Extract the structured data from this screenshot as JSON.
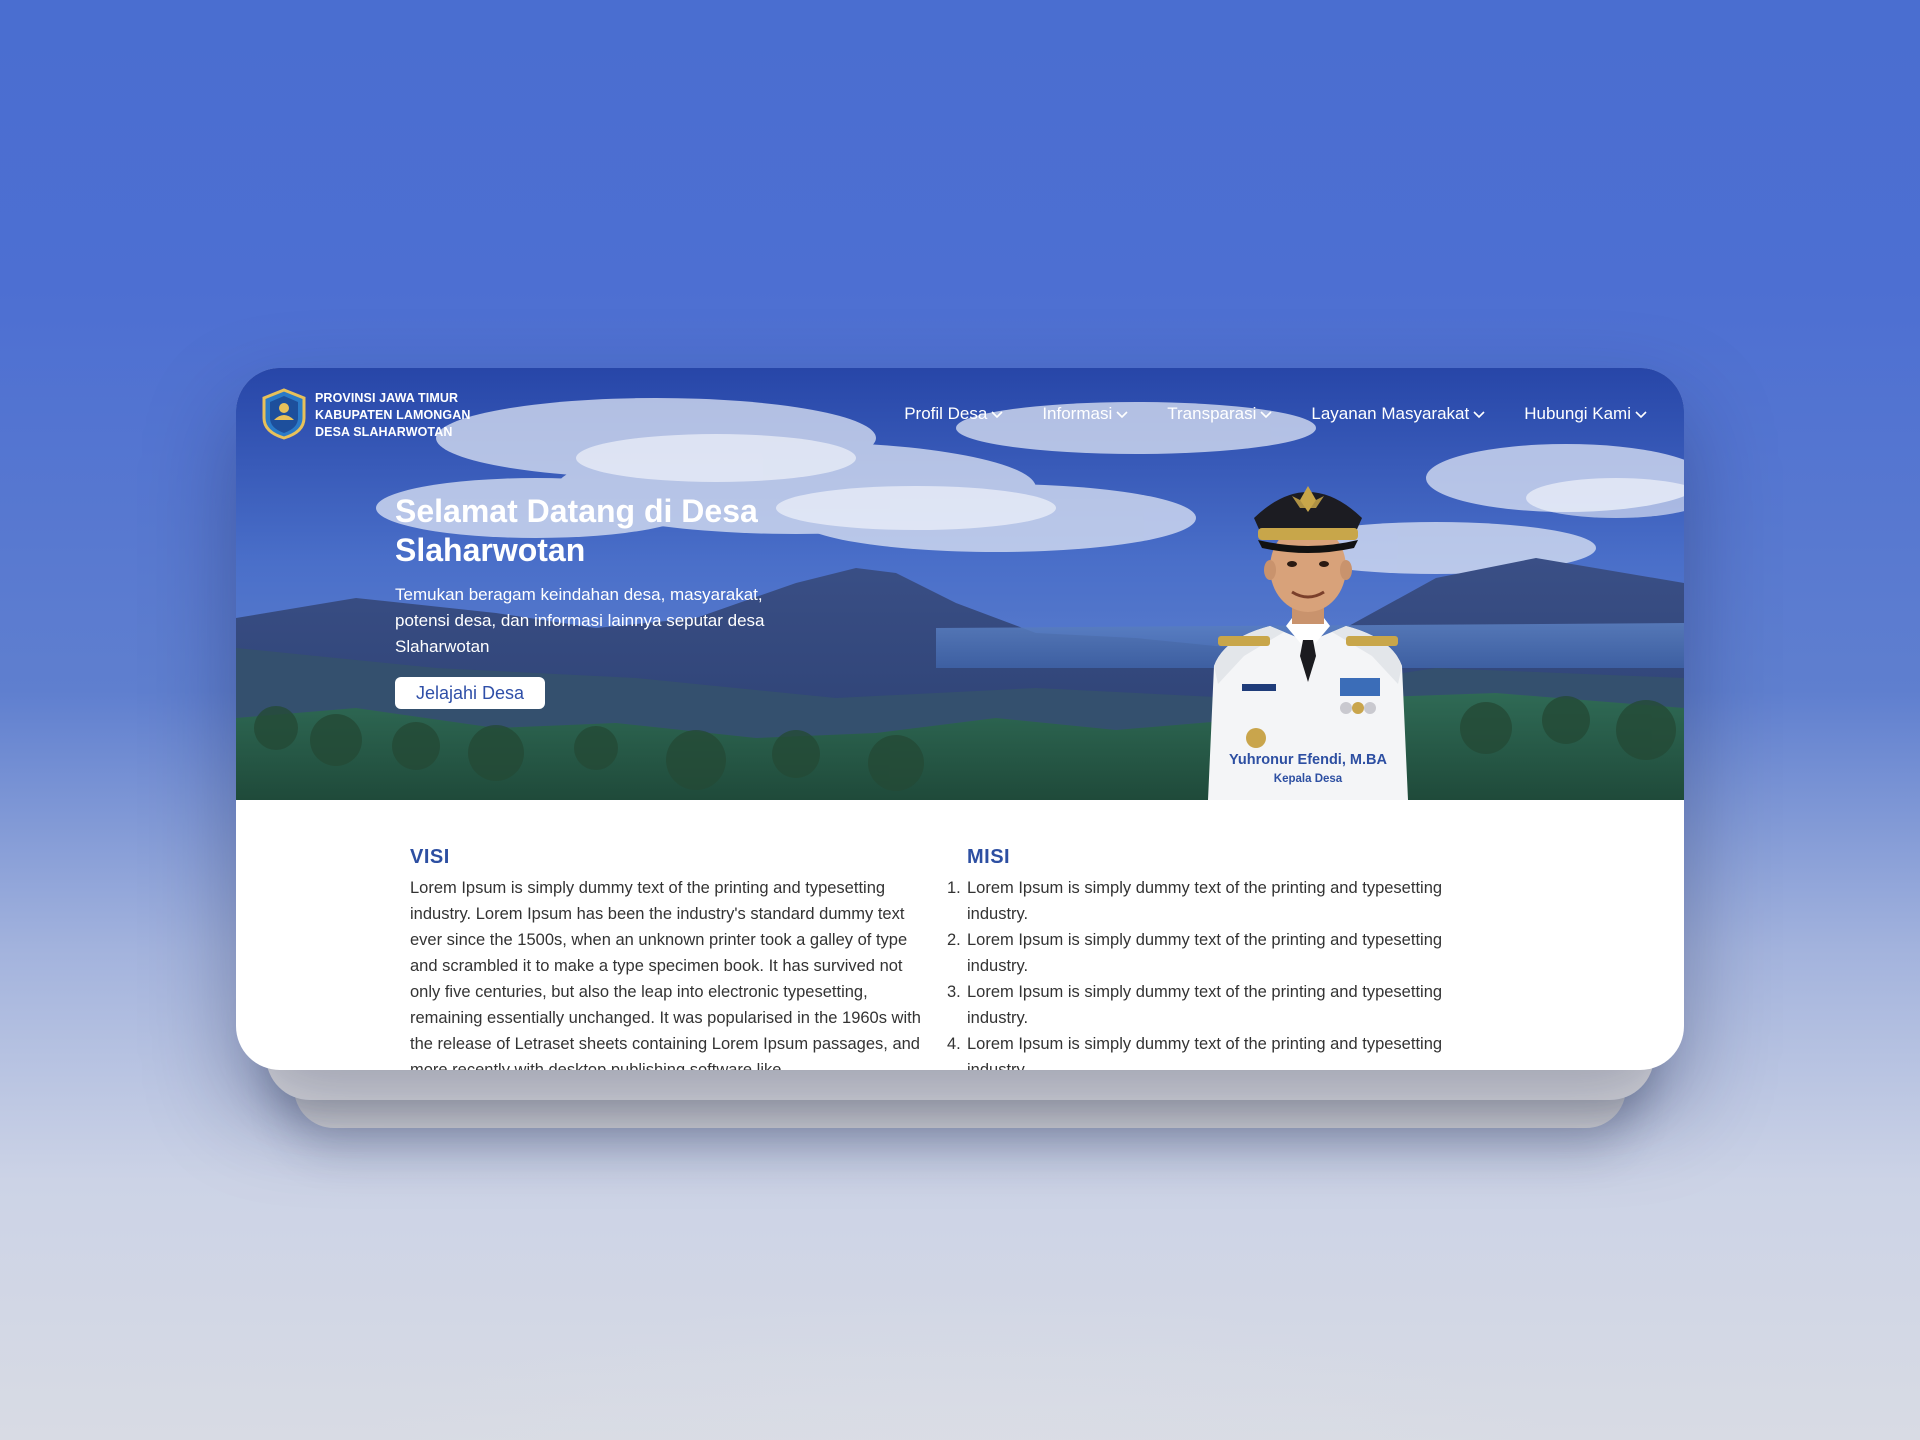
{
  "header": {
    "brand_lines": [
      "PROVINSI JAWA TIMUR",
      "KABUPATEN LAMONGAN",
      "DESA SLAHARWOTAN"
    ],
    "logo_icon": "village-emblem-icon",
    "nav": [
      {
        "label": "Profil Desa",
        "icon": "chevron-down-icon"
      },
      {
        "label": "Informasi",
        "icon": "chevron-down-icon"
      },
      {
        "label": "Transparasi",
        "icon": "chevron-down-icon"
      },
      {
        "label": "Layanan Masyarakat",
        "icon": "chevron-down-icon"
      },
      {
        "label": "Hubungi Kami",
        "icon": "chevron-down-icon"
      }
    ]
  },
  "hero": {
    "title": "Selamat Datang di Desa Slaharwotan",
    "subtitle": "Temukan beragam keindahan desa, masyarakat, potensi desa, dan informasi lainnya seputar desa Slaharwotan",
    "cta_label": "Jelajahi Desa",
    "official_name": "Yuhronur Efendi, M.BA",
    "official_role": "Kepala Desa"
  },
  "visi": {
    "heading": "VISI",
    "text": "Lorem Ipsum is simply dummy text of the printing and typesetting industry. Lorem Ipsum has been the industry's standard dummy text ever since the 1500s, when an unknown printer took a galley of type and scrambled it to make a type specimen book. It has survived not only five centuries, but also the leap into electronic typesetting, remaining essentially unchanged. It was popularised in the 1960s with the release of Letraset sheets containing Lorem Ipsum passages, and more recently with desktop publishing software like"
  },
  "misi": {
    "heading": "MISI",
    "items": [
      {
        "num": "1.",
        "text": "Lorem Ipsum is simply dummy text of the printing and typesetting industry."
      },
      {
        "num": "2.",
        "text": "Lorem Ipsum is simply dummy text of the printing and typesetting industry."
      },
      {
        "num": "3.",
        "text": "Lorem Ipsum is simply dummy text of the printing and typesetting industry."
      },
      {
        "num": "4.",
        "text": "Lorem Ipsum is simply dummy text of the printing and typesetting industry."
      }
    ]
  },
  "colors": {
    "accent": "#2d4fa2",
    "background_top": "#4a6ed0"
  }
}
